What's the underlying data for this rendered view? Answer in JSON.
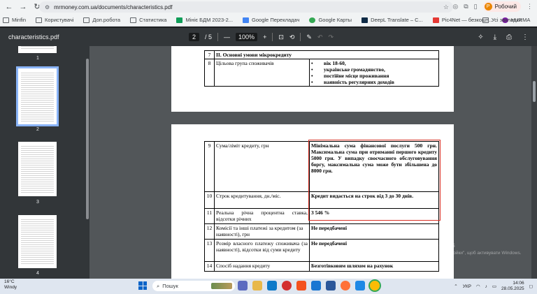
{
  "browser": {
    "url": "mrmoney.com.ua/documents/characteristics.pdf",
    "profile_label": "Робочий",
    "profile_initial": "Р",
    "bookmarks": [
      "Minfin",
      "Користувачі",
      "Доп.робота",
      "Статистика",
      "Мініє БДМ 2023-2...",
      "Google Перекладач",
      "Google Карты",
      "DeepL Translate – С...",
      "Pic4Net — безкошт...",
      "HURMA"
    ],
    "bookmarks_right": "Усі закладки"
  },
  "pdf": {
    "filename": "characteristics.pdf",
    "page_current": "2",
    "page_total": "/ 5",
    "zoom": "100%",
    "thumbnails": [
      "1",
      "2",
      "3",
      "4"
    ]
  },
  "page_top": {
    "rows": [
      {
        "num": "7",
        "label": "ІІ. Основні умови мікрокредиту",
        "value": ""
      },
      {
        "num": "8",
        "label": "Цільова група споживачів",
        "bullets": [
          "вік 18-60,",
          "українське громадянство,",
          "постійне місце проживання",
          "наявність регулярних доходів"
        ]
      }
    ]
  },
  "page_bottom": {
    "rows": [
      {
        "num": "9",
        "label": "Сума/ліміт кредиту, грн",
        "value": "Мінімальна сума фінансової послуги 500 грн. Максимальна сума при отриманні першого кредиту 5000 грн. У випадку своєчасного обслуговування боргу, максимальна сума може бути збільшена до 8000 грн."
      },
      {
        "num": "10",
        "label": "Строк кредитування, дн./міс.",
        "value": "Кредит видається на строк від 3 до 30 днів."
      },
      {
        "num": "11",
        "label": "Реальна річна процентна ставка, відсотки річних",
        "value": "3 546 %"
      },
      {
        "num": "12",
        "label": "Комісії та інші платежі за кредитом (за наявності), грн",
        "value": "Не передбачені"
      },
      {
        "num": "13",
        "label": "Розмір власного платежу споживача (за наявності), відсотки від суми кредиту",
        "value": "Не передбачені"
      },
      {
        "num": "14",
        "label": "Спосіб надання кредиту",
        "value": "Безготівковим шляхом на рахунок"
      }
    ]
  },
  "watermark": {
    "title": "Активація Windows",
    "subtitle": "Перейдіть до розділу \"Настройки\", щоб активувати Windows."
  },
  "taskbar": {
    "weather_temp": "16°C",
    "weather_desc": "Windy",
    "search_placeholder": "Пошук",
    "lang": "УКР",
    "time": "14:06",
    "date": "28.05.2025"
  },
  "colors": {
    "highlight_box": "#d93025",
    "pdf_toolbar": "#323639",
    "viewer_bg": "#525659"
  }
}
